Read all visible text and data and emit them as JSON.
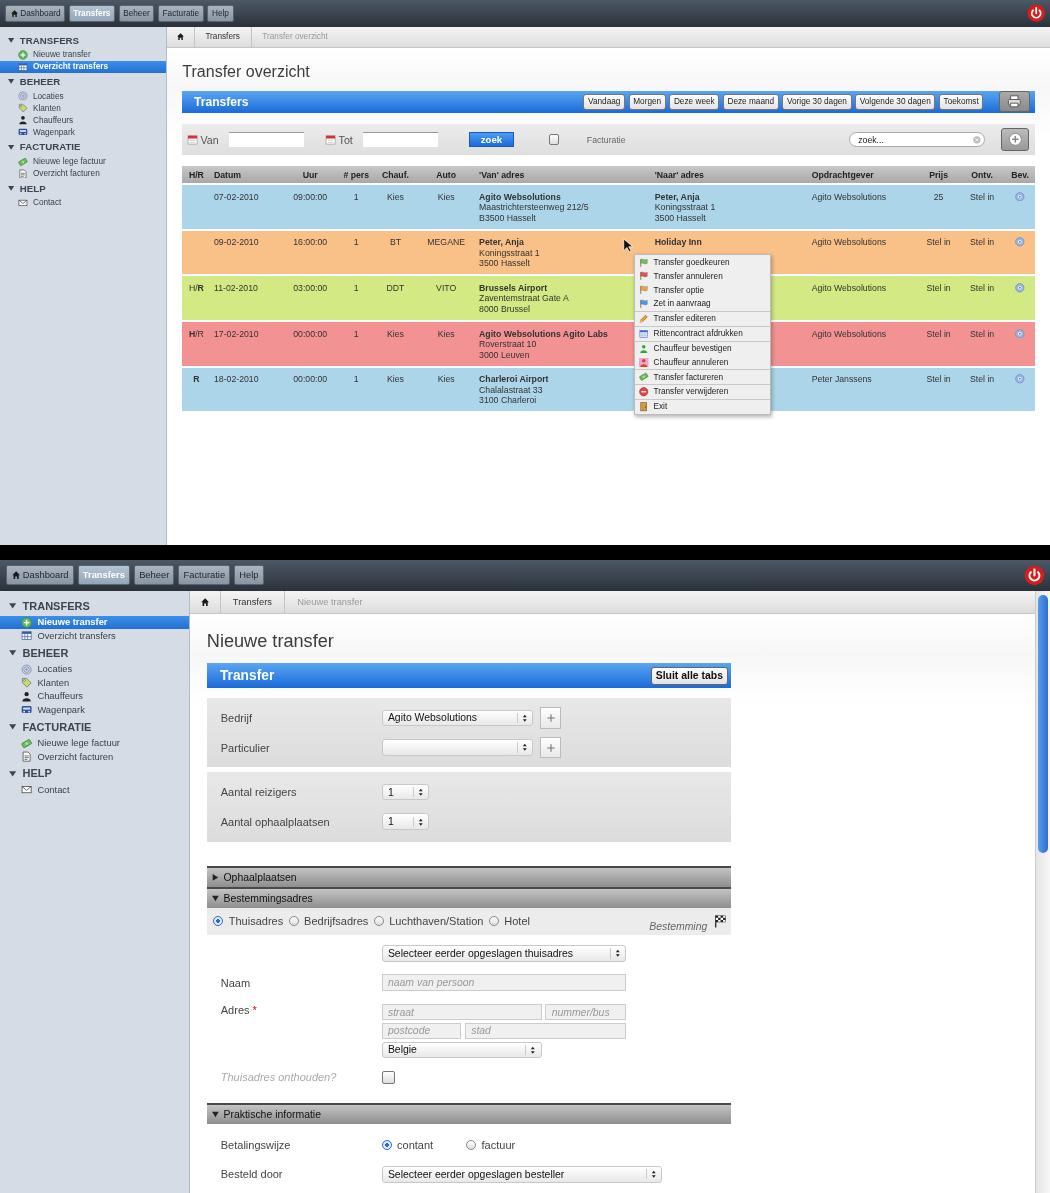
{
  "screens": [
    {
      "kind": "overview",
      "nav": [
        {
          "label": "Dashboard",
          "selected": false
        },
        {
          "label": "Transfers",
          "selected": true
        },
        {
          "label": "Beheer",
          "selected": false
        },
        {
          "label": "Facturatie",
          "selected": false
        },
        {
          "label": "Help",
          "selected": false
        }
      ],
      "sidebar": [
        {
          "heading": "TRANSFERS",
          "items": [
            {
              "label": "Nieuwe transfer",
              "selected": false
            },
            {
              "label": "Overzicht transfers",
              "selected": true
            }
          ]
        },
        {
          "heading": "BEHEER",
          "items": [
            {
              "label": "Locaties",
              "selected": false
            },
            {
              "label": "Klanten",
              "selected": false
            },
            {
              "label": "Chauffeurs",
              "selected": false
            },
            {
              "label": "Wagenpark",
              "selected": false
            }
          ]
        },
        {
          "heading": "FACTURATIE",
          "items": [
            {
              "label": "Nieuwe lege factuur",
              "selected": false
            },
            {
              "label": "Overzicht facturen",
              "selected": false
            }
          ]
        },
        {
          "heading": "HELP",
          "items": [
            {
              "label": "Contact",
              "selected": false
            }
          ]
        }
      ],
      "breadcrumb": [
        "Transfers",
        "Transfer overzicht"
      ],
      "title": "Transfer overzicht",
      "panel_title": "Transfers",
      "ranges": [
        "Vandaag",
        "Morgen",
        "Deze week",
        "Deze maand",
        "Vorige 30 dagen",
        "Volgende 30 dagen",
        "Toekomst"
      ],
      "filter": {
        "from_label": "Van",
        "to_label": "Tot",
        "search_button": "zoek",
        "invoiced_checked": false,
        "invoiced_label": "Facturatie",
        "search_placeholder": "zoek..."
      },
      "table": {
        "columns": [
          "H/R",
          "Datum",
          "Uur",
          "# pers",
          "Chauf.",
          "Auto",
          "'Van' adres",
          "'Naar' adres",
          "Opdrachtgever",
          "Prijs",
          "Ontv.",
          "Bev."
        ],
        "rows": [
          {
            "color": "#acd5ea",
            "date": "07-02-2010",
            "time": "09:00:00",
            "persons": "1",
            "driver": "Kies",
            "car": "Kies",
            "from": {
              "name": "Agito Websolutions",
              "street": "Maastrichtersteenweg 212/5",
              "city": "B3500 Hasselt"
            },
            "to": {
              "name": "Peter, Anja",
              "street": "Koningsstraat 1",
              "city": "3500 Hasselt"
            },
            "client": "Agito Websolutions",
            "price": "25",
            "received": "Stel in"
          },
          {
            "color": "#f9c088",
            "date": "09-02-2010",
            "time": "16:00:00",
            "persons": "1",
            "driver": "BT",
            "car": "MEGANE",
            "from": {
              "name": "Peter, Anja",
              "street": "Koningsstraat 1",
              "city": "3500 Hasselt"
            },
            "to": {
              "name": "Holiday Inn"
            },
            "client": "Agito Websolutions",
            "price": "Stel in",
            "received": "Stel in"
          },
          {
            "color": "#d3e983",
            "hr": "H/**R**",
            "date": "11-02-2010",
            "time": "03:00:00",
            "persons": "1",
            "driver": "DDT",
            "car": "VITO",
            "from": {
              "name": "Brussels Airport",
              "street": "Zaventemstraat Gate A",
              "city": "8000 Brussel"
            },
            "client": "Agito Websolutions",
            "price": "Stel in",
            "received": "Stel in"
          },
          {
            "color": "#f39293",
            "hr": "**H**/R",
            "date": "17-02-2010",
            "time": "00:00:00",
            "persons": "1",
            "driver": "Kies",
            "car": "Kies",
            "from": {
              "name": "Agito Websolutions Agito Labs",
              "street": "Roverstraat 10",
              "city": "3000 Leuven"
            },
            "client": "Agito Websolutions",
            "price": "Stel in",
            "received": "Stel in"
          },
          {
            "color": "#acd5ea",
            "hr": "**R**",
            "date": "18-02-2010",
            "time": "00:00:00",
            "persons": "1",
            "driver": "Kies",
            "car": "Kies",
            "from": {
              "name": "Charleroi Airport",
              "street": "Chalalastraat 33",
              "city": "3100 Charleroi"
            },
            "client": "Peter Janssens",
            "price": "Stel in",
            "received": "Stel in"
          }
        ]
      },
      "context_menu": [
        [
          "Transfer goedkeuren",
          "Transfer annuleren",
          "Transfer optie",
          "Zet in aanvraag"
        ],
        [
          "Transfer editeren"
        ],
        [
          "Rittencontract afdrukken"
        ],
        [
          "Chauffeur bevestigen",
          "Chauffeur annuleren"
        ],
        [
          "Transfer factureren"
        ],
        [
          "Transfer verwijderen"
        ],
        [
          "Exit"
        ]
      ]
    },
    {
      "kind": "form",
      "nav": [
        {
          "label": "Dashboard",
          "selected": false
        },
        {
          "label": "Transfers",
          "selected": true
        },
        {
          "label": "Beheer",
          "selected": false
        },
        {
          "label": "Facturatie",
          "selected": false
        },
        {
          "label": "Help",
          "selected": false
        }
      ],
      "sidebar": [
        {
          "heading": "TRANSFERS",
          "items": [
            {
              "label": "Nieuwe transfer",
              "selected": true
            },
            {
              "label": "Overzicht transfers",
              "selected": false
            }
          ]
        },
        {
          "heading": "BEHEER",
          "items": [
            {
              "label": "Locaties",
              "selected": false
            },
            {
              "label": "Klanten",
              "selected": false
            },
            {
              "label": "Chauffeurs",
              "selected": false
            },
            {
              "label": "Wagenpark",
              "selected": false
            }
          ]
        },
        {
          "heading": "FACTURATIE",
          "items": [
            {
              "label": "Nieuwe lege factuur",
              "selected": false
            },
            {
              "label": "Overzicht facturen",
              "selected": false
            }
          ]
        },
        {
          "heading": "HELP",
          "items": [
            {
              "label": "Contact",
              "selected": false
            }
          ]
        }
      ],
      "breadcrumb": [
        "Transfers",
        "Nieuwe transfer"
      ],
      "title": "Nieuwe transfer",
      "panel_title": "Transfer",
      "close_all": "Sluit alle tabs",
      "client_rows": [
        {
          "label": "Bedrijf",
          "value": "Agito Websolutions"
        },
        {
          "label": "Particulier"
        }
      ],
      "count_rows": [
        {
          "label": "Aantal reizigers",
          "value": "1"
        },
        {
          "label": "Aantal ophaalplaatsen",
          "value": "1"
        }
      ],
      "sections": [
        {
          "kind": "pickups",
          "title": "Ophaalplaatsen",
          "expanded": false
        },
        {
          "kind": "address",
          "title": "Bestemmingsadres",
          "expanded": true,
          "address_types": [
            {
              "label": "Thuisadres",
              "selected": true
            },
            {
              "label": "Bedrijfsadres",
              "selected": false
            },
            {
              "label": "Luchthaven/Station",
              "selected": false
            },
            {
              "label": "Hotel",
              "selected": false
            }
          ],
          "destination_label": "Bestemming",
          "saved_select": "Selecteer eerder opgeslagen thuisadres",
          "name_label": "Naam",
          "name_placeholder": "naam van persoon",
          "address_label": "Adres",
          "required_mark": "*",
          "street_placeholder": "straat",
          "number_placeholder": "nummer/bus",
          "postcode_placeholder": "postcode",
          "city_placeholder": "stad",
          "country": "Belgie",
          "remember_label": "Thuisadres onthouden?",
          "remember_checked": false
        },
        {
          "kind": "practical",
          "title": "Praktische informatie",
          "expanded": true,
          "payment_label": "Betalingswijze",
          "payment_options": [
            {
              "label": "contant",
              "selected": true
            },
            {
              "label": "factuur",
              "selected": false
            }
          ],
          "ordered_by_label": "Besteld door",
          "ordered_by_select": "Selecteer eerder opgeslagen besteller"
        }
      ]
    }
  ]
}
